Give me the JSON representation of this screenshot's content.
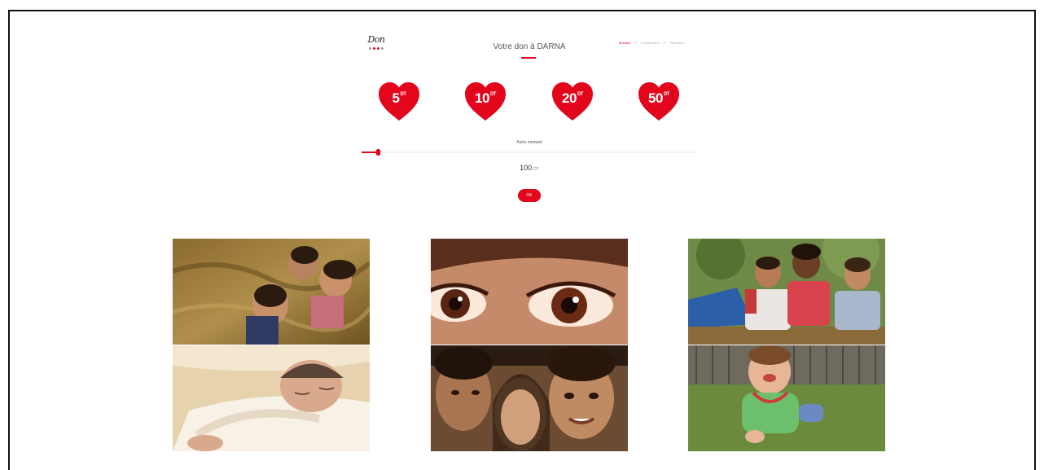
{
  "header": {
    "logo_text": "Don",
    "title": "Votre don à DARNA",
    "steps": [
      "Montant",
      "Coordonnées",
      "Paiement"
    ]
  },
  "amounts": [
    {
      "value": "5",
      "unit": "DT"
    },
    {
      "value": "10",
      "unit": "DT"
    },
    {
      "value": "20",
      "unit": "DT"
    },
    {
      "value": "50",
      "unit": "DT"
    }
  ],
  "custom_amount": {
    "label": "Autre montant",
    "value": "100",
    "currency": "DT",
    "slider_level": 0.05
  },
  "submit": {
    "label": "OK"
  },
  "colors": {
    "accent": "#e3051b",
    "text": "#555555"
  },
  "photos": [
    {
      "name": "photo-children-on-ground"
    },
    {
      "name": "photo-close-up-eyes"
    },
    {
      "name": "photo-children-playing-outdoors"
    },
    {
      "name": "photo-sleeping-baby"
    },
    {
      "name": "photo-children-smiling-faces"
    },
    {
      "name": "photo-toddler-on-grass"
    }
  ]
}
